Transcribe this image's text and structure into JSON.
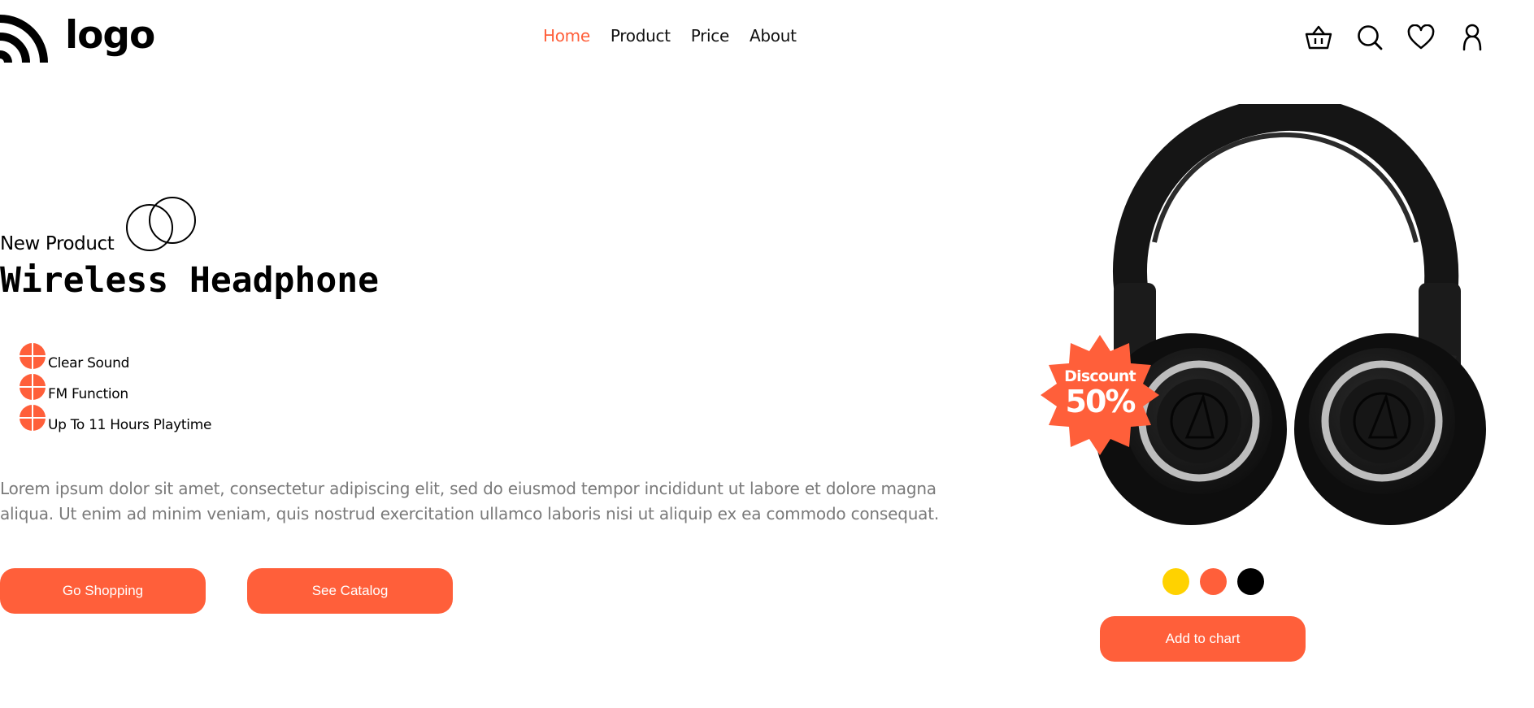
{
  "header": {
    "logo_text": "logo",
    "nav": [
      {
        "label": "Home",
        "active": true
      },
      {
        "label": "Product",
        "active": false
      },
      {
        "label": "Price",
        "active": false
      },
      {
        "label": "About",
        "active": false
      }
    ],
    "icons": [
      "basket-icon",
      "search-icon",
      "heart-icon",
      "user-icon"
    ]
  },
  "hero": {
    "eyebrow": "New Product",
    "headline": "Wireless Headphone",
    "features": [
      "Clear Sound",
      "FM Function",
      "Up To 11 Hours Playtime"
    ],
    "description": "Lorem ipsum dolor sit amet, consectetur adipiscing elit, sed do eiusmod tempor incididunt ut labore et dolore magna aliqua. Ut enim ad minim veniam, quis nostrud exercitation ullamco laboris nisi ut aliquip ex ea commodo consequat.",
    "buttons": {
      "shop": "Go Shopping",
      "catalog": "See Catalog"
    }
  },
  "product": {
    "badge_label": "Discount",
    "badge_value": "50%",
    "colors": [
      "#ffd200",
      "#ff5f3a",
      "#000000"
    ],
    "cart_button": "Add to chart"
  },
  "theme": {
    "accent": "#ff5f3a",
    "muted_text": "#7a7a7a"
  }
}
